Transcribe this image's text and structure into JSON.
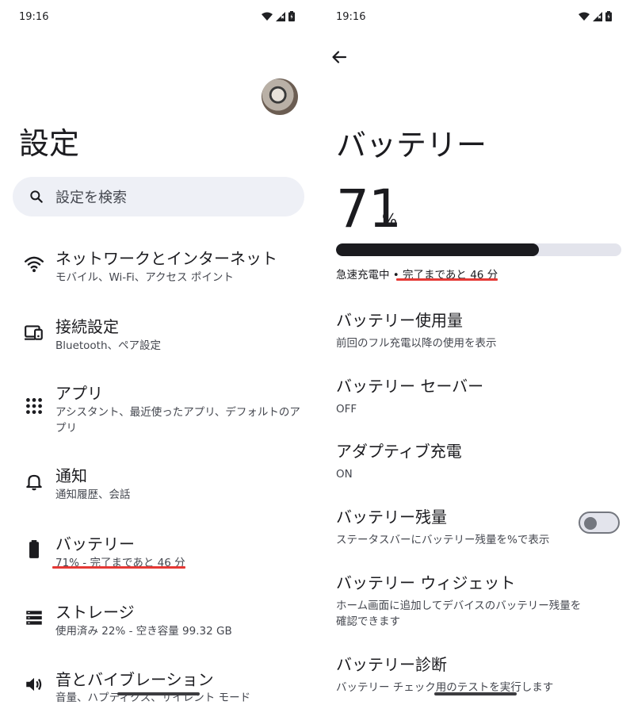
{
  "left": {
    "status": {
      "time": "19:16"
    },
    "title": "設定",
    "search": {
      "placeholder": "設定を検索"
    },
    "items": [
      {
        "title": "ネットワークとインターネット",
        "subtitle": "モバイル、Wi-Fi、アクセス ポイント",
        "icon": "wifi-icon"
      },
      {
        "title": "接続設定",
        "subtitle": "Bluetooth、ペア設定",
        "icon": "connected-devices-icon"
      },
      {
        "title": "アプリ",
        "subtitle": "アシスタント、最近使ったアプリ、デフォルトのアプリ",
        "icon": "apps-grid-icon"
      },
      {
        "title": "通知",
        "subtitle": "通知履歴、会話",
        "icon": "bell-icon"
      },
      {
        "title": "バッテリー",
        "subtitle": "71% - 完了まであと 46 分",
        "icon": "battery-icon"
      },
      {
        "title": "ストレージ",
        "subtitle": "使用済み 22% - 空き容量 99.32 GB",
        "icon": "storage-icon"
      },
      {
        "title": "音とバイブレーション",
        "subtitle": "音量、ハプティクス、サイレント モード",
        "icon": "speaker-icon"
      }
    ]
  },
  "right": {
    "status": {
      "time": "19:16"
    },
    "title": "バッテリー",
    "percent": "71",
    "percent_sign": "%",
    "level": 0.71,
    "charge_status": "急速充電中 • 完了まであと 46 分",
    "items": [
      {
        "title": "バッテリー使用量",
        "subtitle": "前回のフル充電以降の使用を表示"
      },
      {
        "title": "バッテリー セーバー",
        "subtitle": "OFF"
      },
      {
        "title": "アダプティブ充電",
        "subtitle": "ON"
      },
      {
        "title": "バッテリー残量",
        "subtitle": "ステータスバーにバッテリー残量を%で表示",
        "toggle": false
      },
      {
        "title": "バッテリー ウィジェット",
        "subtitle": "ホーム画面に追加してデバイスのバッテリー残量を確認できます"
      },
      {
        "title": "バッテリー診断",
        "subtitle": "バッテリー チェック用のテストを実行します"
      }
    ]
  },
  "colors": {
    "highlight": "#e53935",
    "bar_fill": "#1b1b1f",
    "search_bg": "#eef0f6"
  }
}
